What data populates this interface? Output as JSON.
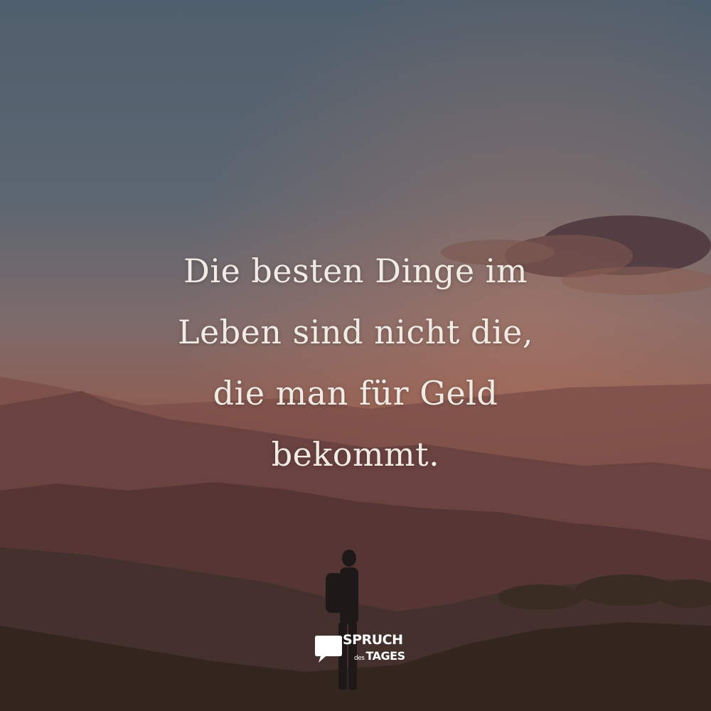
{
  "quote": {
    "lines": [
      "Die besten Dinge im",
      "Leben sind nicht die,",
      "die man für Geld",
      "bekommt."
    ]
  },
  "logo": {
    "line1": "SPRUCH",
    "line2_small": "des",
    "line2": "TAGES"
  },
  "colors": {
    "sky_top": "#536472",
    "sky_horizon": "#8a5a4e",
    "mountains": "#5e3d3a",
    "foreground": "#332620",
    "text": "#f1ebe6"
  }
}
